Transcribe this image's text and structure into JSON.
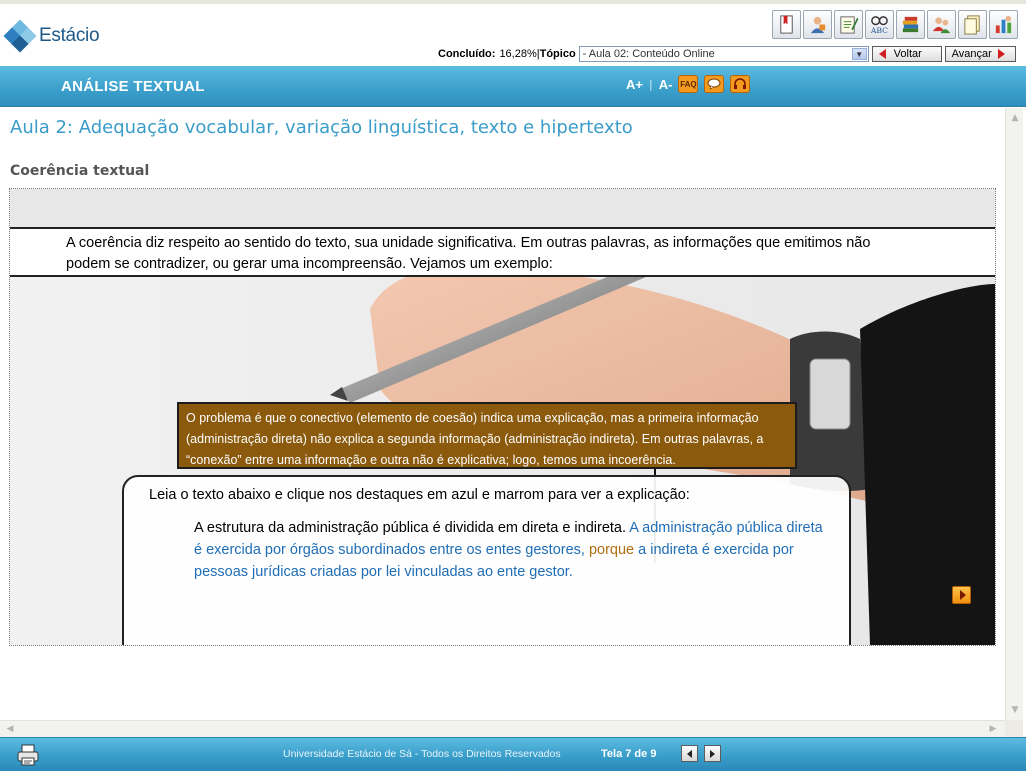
{
  "brand": {
    "logo_text": "Estácio"
  },
  "toolbar": {
    "icons": [
      "bookmark-icon",
      "tutor-icon",
      "notes-icon",
      "glossary-icon",
      "library-icon",
      "forum-icon",
      "documents-icon",
      "reports-icon"
    ]
  },
  "progress": {
    "completed_label": "Concluído:",
    "completed_value": "16,28%",
    "separator": " |",
    "topic_label": "Tópico",
    "topic_selected": "- Aula 02: Conteúdo Online",
    "back_label": "Voltar",
    "next_label": "Avançar"
  },
  "course": {
    "title": "ANÁLISE TEXTUAL",
    "font_increase": "A+",
    "font_separator": "|",
    "font_decrease": "A-",
    "faq_label": "FAQ"
  },
  "lesson": {
    "title": "Aula 2: Adequação vocabular, variação linguística, texto e hipertexto",
    "section": "Coerência textual",
    "intro": "A coerência diz respeito ao sentido do texto, sua unidade significativa. Em outras palavras, as informações que emitimos não podem se contradizer, ou gerar uma incompreensão. Vejamos um exemplo:",
    "explanation": "O problema é que o conectivo (elemento de coesão) indica uma explicação, mas a primeira informação (administração direta) não explica a segunda informação (administração indireta). Em outras palavras, a “conexão” entre uma informação e outra não é explicativa; logo, temos uma incoerência.",
    "instruction": "Leia o texto abaixo e clique nos destaques em azul e marrom para ver a explicação:",
    "example": {
      "plain": "A estrutura da administração pública é dividida em direta e indireta. ",
      "blue1": "A administração pública direta é exercida por órgãos subordinados entre os entes gestores,",
      "space1": " ",
      "brown": "porque",
      "space2": " ",
      "blue2": "a indireta é exercida por pessoas jurídicas criadas por lei vinculadas ao ente gestor."
    }
  },
  "colors": {
    "accent_blue": "#3a9cc8",
    "header_bar": "#3b9fcb",
    "explanation_bg": "#8b5a0c",
    "highlight_blue": "#1f6db5",
    "highlight_brown": "#b06e10"
  },
  "footer": {
    "copyright": "Universidade Estácio de Sá - Todos os Direitos Reservados",
    "screen_counter": "Tela 7 de 9"
  }
}
